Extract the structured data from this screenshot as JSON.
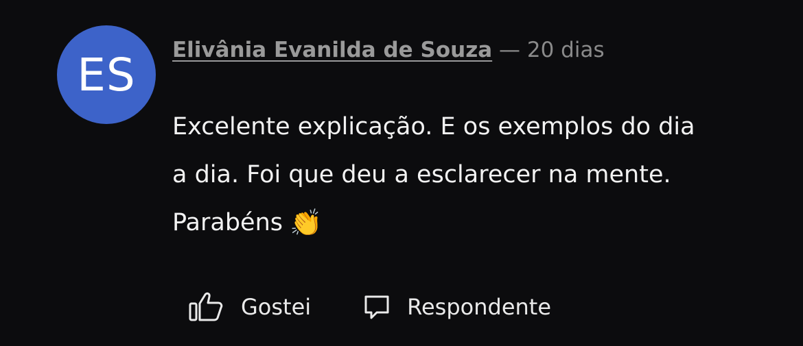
{
  "comment": {
    "avatar_initials": "ES",
    "avatar_color": "#3d63c9",
    "author": "Elivânia Evanilda de Souza",
    "separator": "—",
    "time_ago": "20 dias",
    "body_lines": [
      "Excelente explicação. E os exemplos do dia",
      "a dia. Foi que deu a esclarecer na mente.",
      "Parabéns"
    ],
    "emoji": "👏",
    "emoji_name": "clapping-hands-icon"
  },
  "actions": {
    "like_label": "Gostei",
    "like_icon": "thumbs-up-icon",
    "reply_label": "Respondente",
    "reply_icon": "speech-bubble-icon"
  }
}
